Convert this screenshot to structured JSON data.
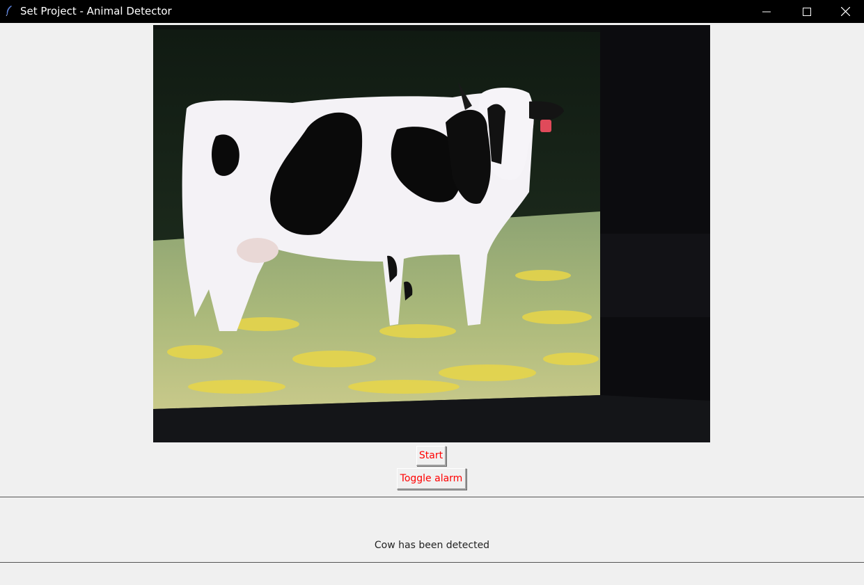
{
  "window": {
    "title": "Set Project - Animal Detector",
    "controls": [
      "minimize-icon",
      "maximize-icon",
      "close-icon"
    ]
  },
  "video_feed": {
    "content": "webcam view of a printed cow photo"
  },
  "buttons": {
    "start_label": "Start",
    "toggle_alarm_label": "Toggle alarm",
    "text_color": "#ff0000"
  },
  "status": {
    "message": "Cow has been detected"
  }
}
